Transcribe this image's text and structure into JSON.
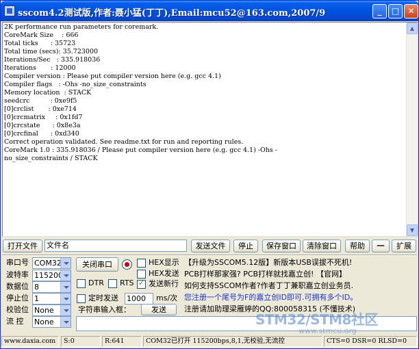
{
  "window": {
    "title": "sscom4.2测试版,作者:聂小猛(丁丁),Email:mcu52@163.com,2007/9"
  },
  "receive": {
    "lines": [
      "2K performance run parameters for coremark.",
      "CoreMark Size    : 666",
      "Total ticks      : 35723",
      "Total time (secs): 35.723000",
      "Iterations/Sec   : 335.918036",
      "Iterations       : 12000",
      "Compiler version : Please put compiler version here (e.g. gcc 4.1)",
      "Compiler flags   : -Ohs -no_size_constraints",
      "Memory location  : STACK",
      "seedcrc          : 0xe9f5",
      "[0]crclist       : 0xe714",
      "[0]crcmatrix     : 0x1fd7",
      "[0]crcstate      : 0x8e3a",
      "[0]crcfinal      : 0xd340",
      "Correct operation validated. See readme.txt for run and reporting rules.",
      "CoreMark 1.0 : 335.918036 / Please put compiler version here (e.g. gcc 4.1) -Ohs -",
      "no_size_constraints / STACK"
    ]
  },
  "toolbar": {
    "open_file": "打开文件",
    "filename": "文件名",
    "send_file": "发送文件",
    "stop": "停止",
    "save_window": "保存窗口",
    "clear_window": "清除窗口",
    "help": "帮助",
    "minus": "一",
    "expand": "扩展"
  },
  "serial": {
    "port_label": "串口号",
    "port_value": "COM32",
    "baud_label": "波特率",
    "baud_value": "115200",
    "databits_label": "数据位",
    "databits_value": "8",
    "stopbits_label": "停止位",
    "stopbits_value": "1",
    "parity_label": "校验位",
    "parity_value": "None",
    "flow_label": "流 控",
    "flow_value": "None"
  },
  "controls": {
    "close_port": "关闭串口",
    "hex_display": "HEX显示",
    "hex_send": "HEX发送",
    "dtr": "DTR",
    "rts": "RTS",
    "send_newline": "发送新行",
    "timed_send": "定时发送",
    "interval_value": "1000",
    "interval_unit": "ms/次",
    "input_label": "字符串输入框：",
    "send": "发送"
  },
  "info": {
    "line1": "【升级为SSCOM5.12版】新版本USB误拔不死机!",
    "line2": "PCB打样那家强? PCB打样就找嘉立创! 【官网】",
    "line3": "如何支持SSCOM作者?作者丁丁兼职嘉立创业务员.",
    "line4": "您注册一个尾号为F的嘉立创ID即可.可拥有多个ID。",
    "line5": "注册请加助理梁雁婷的QQ:800058315 (不懂技术)",
    "line4_color": "#1d36c8"
  },
  "status": {
    "website": "www.daxia.com",
    "sent": "S:0",
    "received": "R:641",
    "port_status": "COM32已打开  115200bps,8,1,无校验,无流控",
    "signals": "CTS=0 DSR=0 RLSD=0"
  },
  "watermark": {
    "brand": "STM32/STM8社区",
    "url": "www.stmcu.org"
  }
}
